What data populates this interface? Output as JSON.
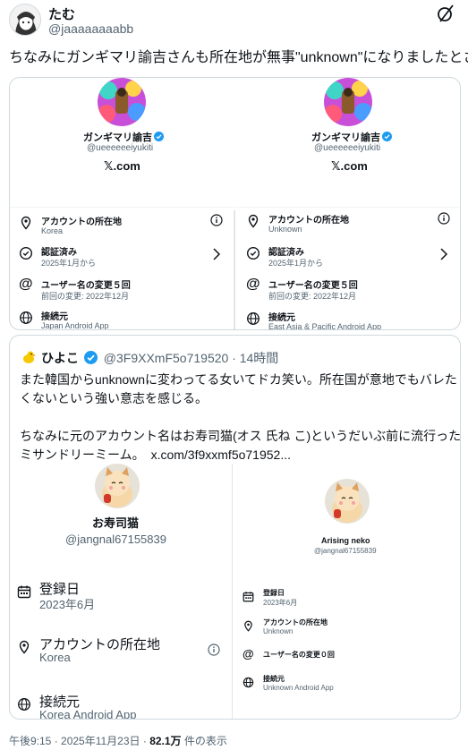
{
  "post": {
    "author_name": "たむ",
    "author_handle": "@jaaaaaaaabb",
    "text": "ちなみにガンギマリ諭吉さんも所在地が無事\"unknown\"になりましたとさ"
  },
  "card1": {
    "left": {
      "name": "ガンギマリ諭吉",
      "handle": "@ueeeeeeiyukiti",
      "site": "𝕏.com",
      "rows": [
        {
          "title": "アカウントの所在地",
          "sub": "Korea"
        },
        {
          "title": "認証済み",
          "sub": "2025年1月から"
        },
        {
          "title": "ユーザー名の変更５回",
          "sub": "前回の変更: 2022年12月"
        },
        {
          "title": "接続元",
          "sub": "Japan Android App"
        }
      ]
    },
    "right": {
      "name": "ガンギマリ諭吉",
      "handle": "@ueeeeeeiyukiti",
      "site": "𝕏.com",
      "rows": [
        {
          "title": "アカウントの所在地",
          "sub": "Unknown"
        },
        {
          "title": "認証済み",
          "sub": "2025年1月から"
        },
        {
          "title": "ユーザー名の変更５回",
          "sub": "前回の変更: 2022年12月"
        },
        {
          "title": "接続元",
          "sub": "East Asia & Pacific Android App"
        }
      ]
    }
  },
  "quote": {
    "author_name": "ひよこ",
    "author_handle": "@3F9XXmF5o719520",
    "time": "· 14時間",
    "lines": [
      "また韓国からunknownに変わってる女いてドカ笑い。所在国が意地でもバレた",
      "くないという強い意志を感じる。",
      "",
      "ちなみに元のアカウント名はお寿司猫(オス 氏ね こ)というだいぶ前に流行った",
      "ミサンドリーミーム。　x.com/3f9xxmf5o71952..."
    ],
    "left": {
      "name": "お寿司猫",
      "handle": "@jangnal67155839",
      "rows": [
        {
          "title": "登録日",
          "sub": "2023年6月"
        },
        {
          "title": "アカウントの所在地",
          "sub": "Korea"
        },
        {
          "title": "接続元",
          "sub": "Korea Android App"
        }
      ]
    },
    "right": {
      "name": "Arising neko",
      "handle": "@jangnal67155839",
      "rows": [
        {
          "title": "登録日",
          "sub": "2023年6月"
        },
        {
          "title": "アカウントの所在地",
          "sub": "Unknown"
        },
        {
          "title": "ユーザー名の変更０回",
          "sub": ""
        },
        {
          "title": "接続元",
          "sub": "Unknown Android App"
        }
      ]
    }
  },
  "footer": {
    "time": "午後9:15 · 2025年11月23日 · ",
    "views": "82.1万",
    "views_suffix": " 件の表示"
  },
  "colors": {
    "verified": "#1d9bf0",
    "text": "#0f1419",
    "muted": "#536471",
    "border": "#cfd9de"
  }
}
